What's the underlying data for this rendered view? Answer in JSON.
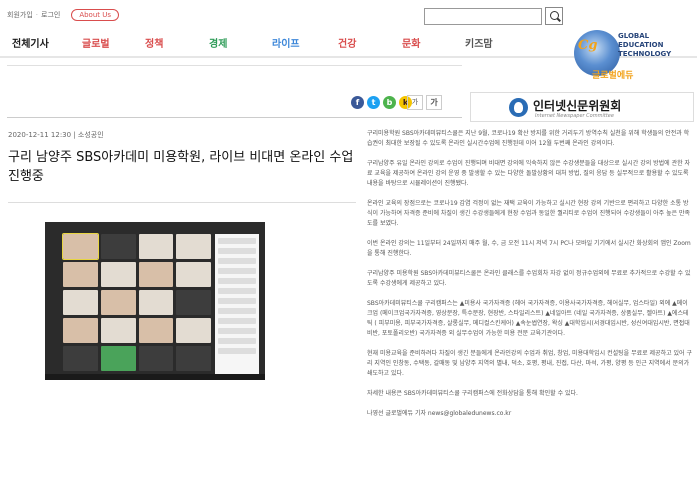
{
  "top": {
    "signup": "회원가입",
    "login": "로그인",
    "about": "About Us"
  },
  "nav": [
    {
      "label": "전체기사",
      "color": "#1a1a1a"
    },
    {
      "label": "글로벌",
      "color": "#d94d4d"
    },
    {
      "label": "정책",
      "color": "#d94d4d"
    },
    {
      "label": "경제",
      "color": "#2e9c58"
    },
    {
      "label": "라이프",
      "color": "#3d87d9"
    },
    {
      "label": "건강",
      "color": "#d94d4d"
    },
    {
      "label": "문화",
      "color": "#d94d4d"
    },
    {
      "label": "키즈맘",
      "color": "#555555"
    }
  ],
  "logo": {
    "mark": "Cg",
    "line1": "GLOBAL",
    "line2": "EDUCATION",
    "line3": "TECHNOLOGY",
    "korean": "글로벌에듀"
  },
  "share": {
    "facebook": "f",
    "twitter": "t",
    "blog": "b",
    "kakao": "k"
  },
  "font_buttons": {
    "smaller": "가",
    "larger": "가"
  },
  "banner": {
    "title": "인터넷신문위원회",
    "subtitle": "Internet Newspaper Committee"
  },
  "article": {
    "meta": "2020-12-11 12:30  |  소성공인",
    "title": "구리 남양주 SBS아카데미 미용학원, 라이브 비대면 온라인 수업 진행중",
    "photo_label": "온라인 수업 화면",
    "paragraphs": [
      "구리미용학원 SBS아카데미뷰티스쿨은 지난 9월, 코로나19 확산 방지를 위한 거리두기 방역수칙 실천을 위해 학생들의 안전과 학습권이 최대한 보장될 수 있도록 온라인 실시간수업에 진행된데 이어 12월 두번째 온라인 강의이다.",
      "구리남양주 유일 온라인 강의로 수업이 진행되며 비대면 강의에 익숙하지 않은 수강생분들을 대상으로 실시간 강의 방법에 관한 자료 교육을 제공하여 온라인 강의 운영 중 발생할 수 있는 다양한 돌발상황의 대처 방법, 질의 응답 등 실무적으로 활용할 수 있도록 내용을 바탕으로 시뮬레이션이 진행됐다.",
      "온라인 교육의 장점으로는 코로나19 감염 걱정이 없는 재택 교육이 가능하고 실시간 현장 강의 기반으로 편리하고 다양한 소통 방식이 가능하여 자격증 준비에 차질이 생긴 수강생들에게 현장 수업과 동일한 퀄리티로 수업이 진행되어 수강생들이 아주 높은 만족도를 보였다.",
      "이번 온라인 강의는 11일부터 24일까지 매주 월, 수, 금 오전 11시 저녁 7시 PC나 모바일 기기에서 실시간 화상회의 앱인 Zoom을 통해 진행한다.",
      "구리남양주 미용학원 SBS아카데미뷰티스쿨은 온라인 클래스를 수업회차 자강 없이 정규수업외에 무료로 추가적으로 수강할 수 있도록 수강생에게 제공하고 있다.",
      "SBS아카데미뷰티스쿨 구리캠퍼스는 ▲미용사 국가자격증 (헤어 국가자격증, 이용사국가자격증, 헤어실무, 업스타일) 외에 ▲메이크업 (메이크업국가자격증, 영상분장, 특수분장, 현장반, 스타일리스트) ▲네일아트 (네일 국가자격증, 상품실무, 젤아트) ▲에스테틱 ( 피부미용, 피부국가자격증, 살롱실무, 메디컬스킨케어) ▲속눈썹연장, 왁싱 ▲대학입시(서경대입시반, 성신여대입시반, 면접대비반, 포토폴리오반) 국가자격증 외 실무수업이 가능한 미용 전문 교육기관이다.",
      "현재 미용교육을 준비하려다 차질이 생긴 분들에게 온라인강의 수업과 취업, 창업, 미용대학입시 컨설팅을 무료로 제공하고 있어 구리 지역인 인창동, 수택동, 갈매동 및 남양주 지역의 별내, 덕소, 호평, 평내, 진접, 다산, 마석, 가평, 양평 등 인근 지역에서 문의가 쇄도하고 있다.",
      "자세한 내용은 SBS아카데미뷰티스쿨 구리캠퍼스에 전화상담을 통해 확인할 수 있다.",
      "나영선 글로벌에듀 기자 news@globaledunews.co.kr"
    ]
  }
}
